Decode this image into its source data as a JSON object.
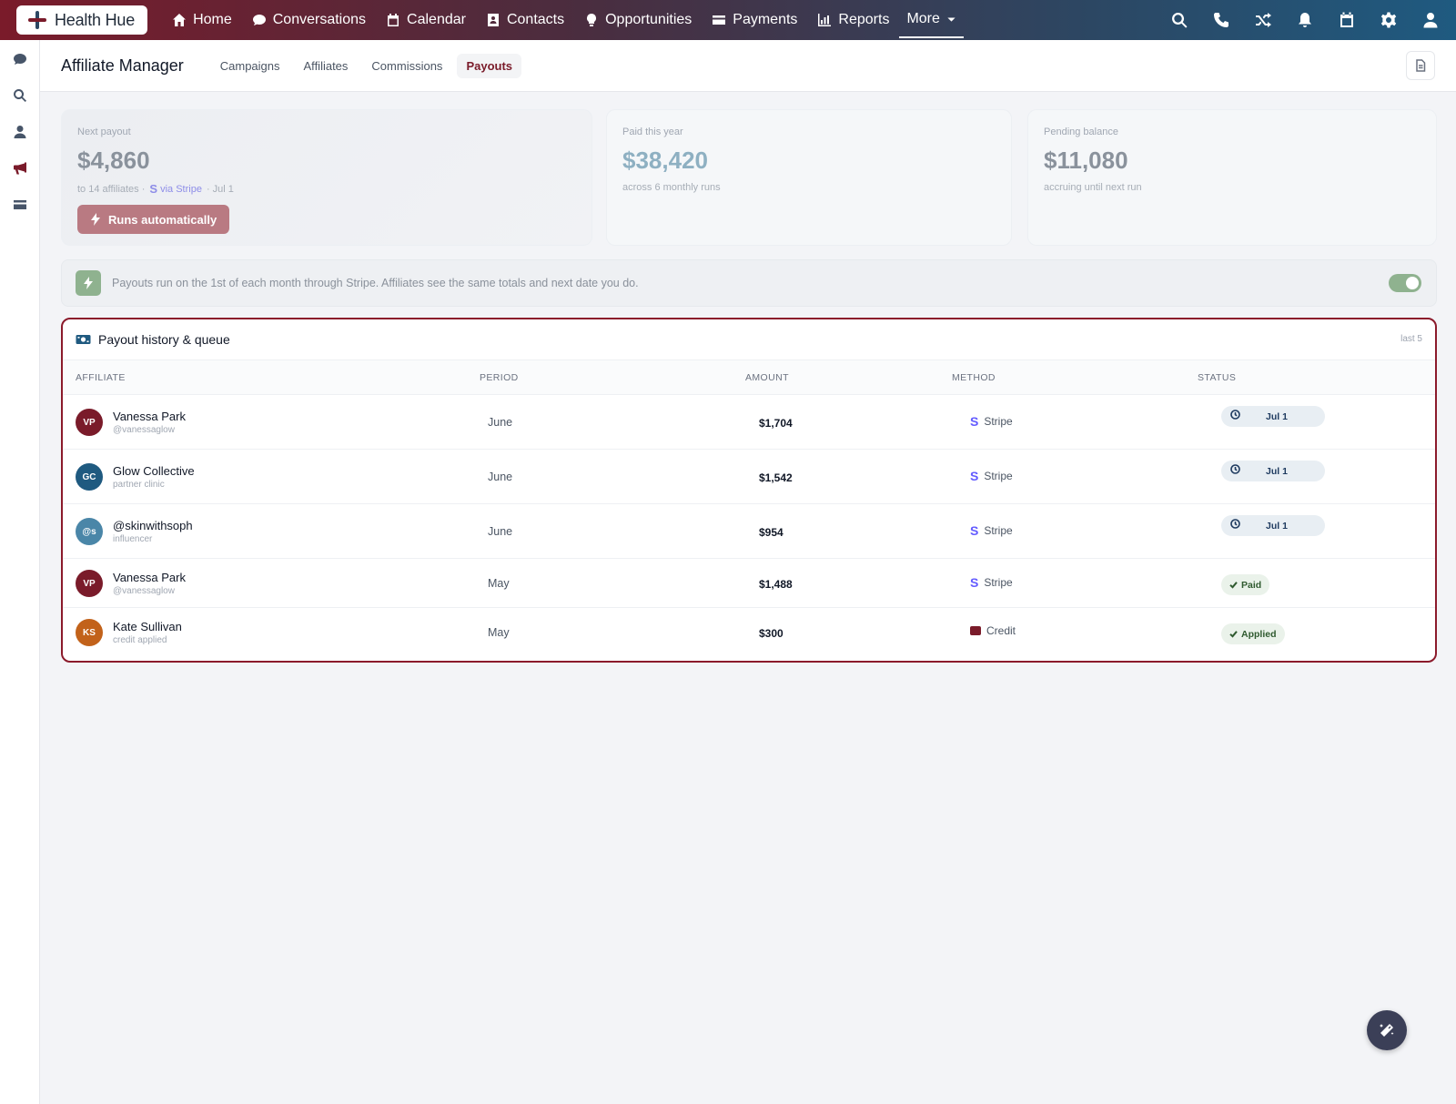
{
  "brand": {
    "name": "Health Hue"
  },
  "nav": {
    "items": [
      {
        "label": "Home",
        "icon": "home-icon"
      },
      {
        "label": "Conversations",
        "icon": "chat-icon"
      },
      {
        "label": "Calendar",
        "icon": "calendar-icon"
      },
      {
        "label": "Contacts",
        "icon": "contacts-icon"
      },
      {
        "label": "Opportunities",
        "icon": "lightbulb-icon"
      },
      {
        "label": "Payments",
        "icon": "credit-card-icon"
      },
      {
        "label": "Reports",
        "icon": "bar-chart-icon"
      }
    ],
    "more_label": "More",
    "right_icons": [
      "search-icon",
      "phone-icon",
      "shuffle-icon",
      "bell-icon",
      "calendar-icon",
      "gear-icon",
      "user-icon"
    ]
  },
  "siderail": {
    "icons": [
      "chat-icon",
      "search-icon",
      "user-icon",
      "megaphone-icon",
      "credit-card-icon"
    ],
    "active_index": 3
  },
  "header": {
    "title": "Affiliate Manager",
    "tabs": [
      {
        "label": "Campaigns"
      },
      {
        "label": "Affiliates"
      },
      {
        "label": "Commissions"
      },
      {
        "label": "Payouts"
      }
    ],
    "active_tab": "Payouts"
  },
  "stats": {
    "next_payout": {
      "label": "Next payout",
      "value": "$4,860",
      "sub_prefix": "to 14 affiliates ·",
      "via": "via Stripe",
      "date": "· Jul 1",
      "button_label": "Runs automatically"
    },
    "paid_year": {
      "label": "Paid this year",
      "value": "$38,420",
      "sub": "across 6 monthly runs"
    },
    "pending": {
      "label": "Pending balance",
      "value": "$11,080",
      "sub": "accruing until next run"
    }
  },
  "banner": {
    "text": "Payouts run on the 1st of each month through Stripe. Affiliates see the same totals and next date you do.",
    "toggle_on": true
  },
  "payouts": {
    "title": "Payout history & queue",
    "count_label": "last 5",
    "columns": [
      "AFFILIATE",
      "PERIOD",
      "AMOUNT",
      "METHOD",
      "STATUS"
    ],
    "rows": [
      {
        "initials": "VP",
        "avatar_color": "#7a1b2a",
        "name": "Vanessa Park",
        "sub": "@vanessaglow",
        "period": "June",
        "amount": "$1,704",
        "method": "Stripe",
        "status": "Jul 1",
        "status_type": "scheduled"
      },
      {
        "initials": "GC",
        "avatar_color": "#1f5a80",
        "name": "Glow Collective",
        "sub": "partner clinic",
        "period": "June",
        "amount": "$1,542",
        "method": "Stripe",
        "status": "Jul 1",
        "status_type": "scheduled"
      },
      {
        "initials": "@s",
        "avatar_color": "#4a86a8",
        "name": "@skinwithsoph",
        "sub": "influencer",
        "period": "June",
        "amount": "$954",
        "method": "Stripe",
        "status": "Jul 1",
        "status_type": "scheduled"
      },
      {
        "initials": "VP",
        "avatar_color": "#7a1b2a",
        "name": "Vanessa Park",
        "sub": "@vanessaglow",
        "period": "May",
        "amount": "$1,488",
        "method": "Stripe",
        "status": "Paid",
        "status_type": "done"
      },
      {
        "initials": "KS",
        "avatar_color": "#c2621a",
        "name": "Kate Sullivan",
        "sub": "credit applied",
        "period": "May",
        "amount": "$300",
        "method": "Credit",
        "status": "Applied",
        "status_type": "done"
      }
    ]
  },
  "colors": {
    "brand_primary": "#7a1b2a",
    "brand_secondary": "#1f5a80",
    "stripe": "#635bff",
    "success": "#2f5a2f"
  }
}
